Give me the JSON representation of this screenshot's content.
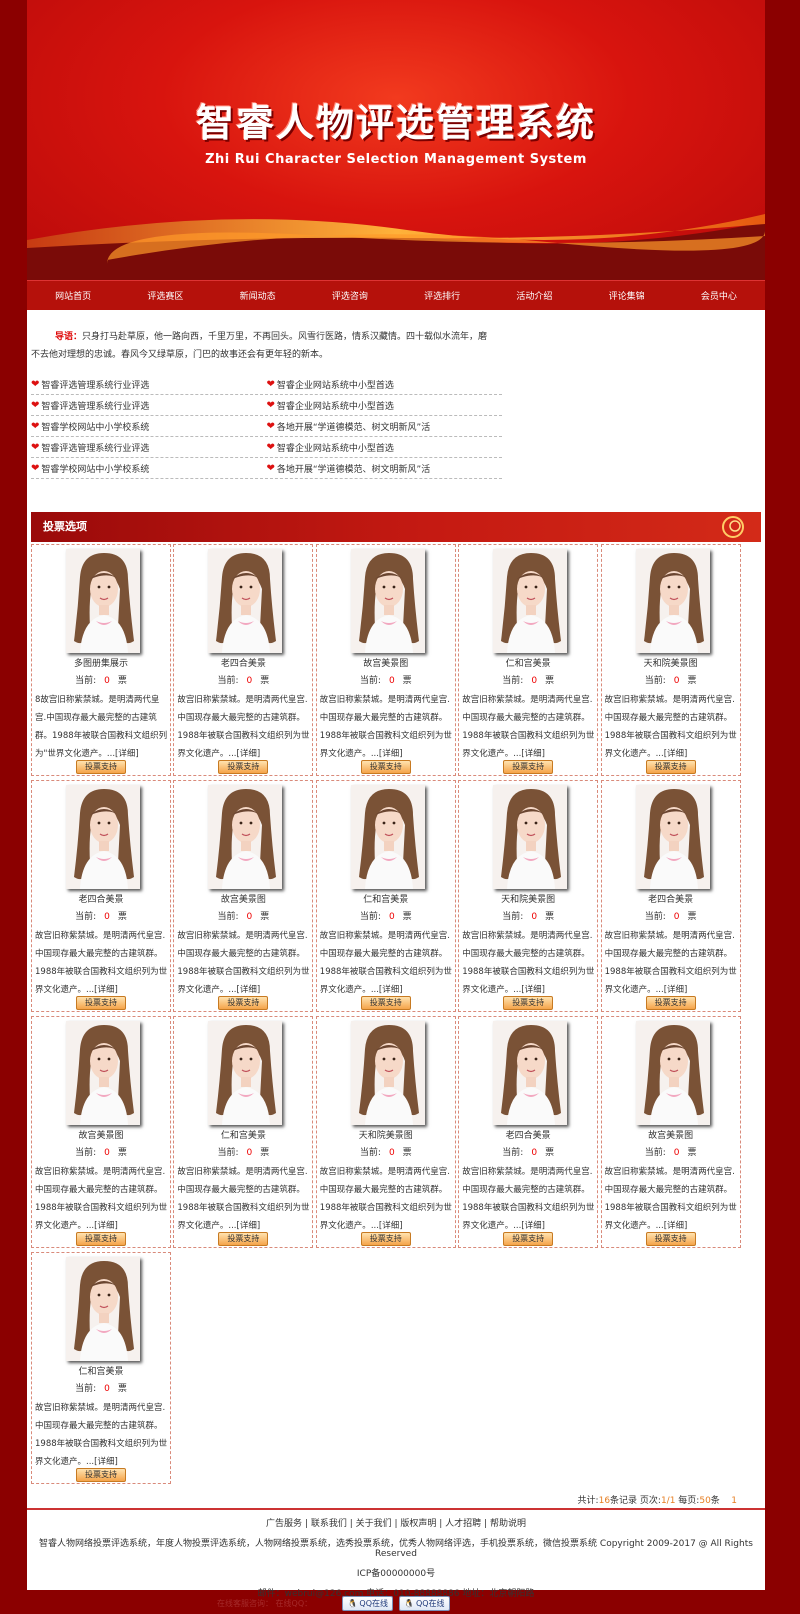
{
  "banner": {
    "title": "智睿人物评选管理系统",
    "subtitle": "Zhi Rui Character Selection Management System"
  },
  "nav": [
    "网站首页",
    "评选赛区",
    "新闻动态",
    "评选咨询",
    "评选排行",
    "活动介绍",
    "评论集锦",
    "会员中心"
  ],
  "intro": {
    "lead": "导语：",
    "text": "只身打马赴草原，他一路向西，千里万里，不再回头。风雪行医路，情系汉藏情。四十载似水流年，磨不去他对理想的忠诚。春风今又绿草原，门巴的故事还会有更年轻的新本。"
  },
  "news": [
    [
      "智睿评选管理系统行业评选",
      "智睿企业网站系统中小型首选"
    ],
    [
      "智睿评选管理系统行业评选",
      "智睿企业网站系统中小型首选"
    ],
    [
      "智睿学校网站中小学校系统",
      "各地开展“学道德模范、树文明新风”活"
    ],
    [
      "智睿评选管理系统行业评选",
      "智睿企业网站系统中小型首选"
    ],
    [
      "智睿学校网站中小学校系统",
      "各地开展“学道德模范、树文明新风”活"
    ]
  ],
  "vote": {
    "heading": "投票选项",
    "current_label": "当前:",
    "unit": "票",
    "button": "投票支持",
    "more": "...[详细]",
    "desc": "故宫旧称紫禁城。是明清两代皇宫.中国现存最大最完整的古建筑群。1988年被联合国教科文组织列为世界文化遗产。",
    "desc_first": "8故宫旧称紫禁城。是明清两代皇宫.中国现存最大最完整的古建筑群。1988年被联合国教科文组织列为\"世界文化遗产。",
    "items": [
      {
        "name": "多图册集展示",
        "votes": "0"
      },
      {
        "name": "老四合美景",
        "votes": "0"
      },
      {
        "name": "故宫美景图",
        "votes": "0"
      },
      {
        "name": "仁和宫美景",
        "votes": "0"
      },
      {
        "name": "天和院美景图",
        "votes": "0"
      },
      {
        "name": "老四合美景",
        "votes": "0"
      },
      {
        "name": "故宫美景图",
        "votes": "0"
      },
      {
        "name": "仁和宫美景",
        "votes": "0"
      },
      {
        "name": "天和院美景图",
        "votes": "0"
      },
      {
        "name": "老四合美景",
        "votes": "0"
      },
      {
        "name": "故宫美景图",
        "votes": "0"
      },
      {
        "name": "仁和宫美景",
        "votes": "0"
      },
      {
        "name": "天和院美景图",
        "votes": "0"
      },
      {
        "name": "老四合美景",
        "votes": "0"
      },
      {
        "name": "故宫美景图",
        "votes": "0"
      },
      {
        "name": "仁和宫美景",
        "votes": "0"
      }
    ]
  },
  "pager": {
    "total_label": "共计:",
    "total": "16",
    "records": "条记录 页次:",
    "page": "1/1",
    "per_label": " 每页:",
    "per": "50",
    "per_unit": "条",
    "current": "1"
  },
  "footer": {
    "links": [
      "广告服务",
      "联系我们",
      "关于我们",
      "版权声明",
      "人才招聘",
      "帮助说明"
    ],
    "keywords": "智睿人物网络投票评选系统，年度人物投票评选系统，人物网络投票系统，选秀投票系统，优秀人物网络评选，手机投票系统，微信投票系统 Copyright 2009-2017 @ All Rights Reserved",
    "icp": "ICP备00000000号",
    "contact": "邮件：webrui@126.com 电话：010-88888886    地址：北京朝阳路",
    "qq_label": "QQ在线",
    "faint": "在线客服咨询：   在线QQ："
  },
  "colors": {
    "brand_red": "#b5110b",
    "dark_red": "#8b0000",
    "vote_count": "#e00000"
  }
}
